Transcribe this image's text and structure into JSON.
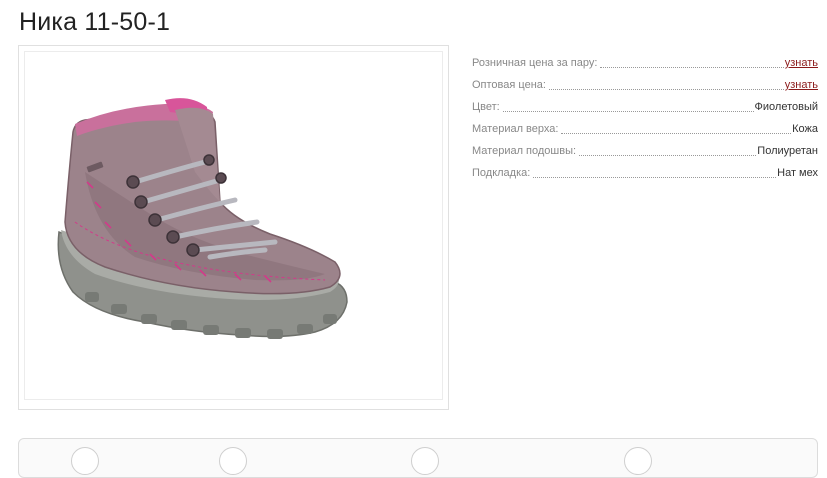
{
  "product": {
    "title": "Ника 11-50-1",
    "image_alt": "Фиолетовый ботинок"
  },
  "specs": [
    {
      "label": "Розничная цена за пару:",
      "value": "узнать",
      "is_link": true
    },
    {
      "label": "Оптовая цена:",
      "value": "узнать",
      "is_link": true
    },
    {
      "label": "Цвет:",
      "value": "Фиолетовый",
      "is_link": false
    },
    {
      "label": "Материал верха:",
      "value": "Кожа",
      "is_link": false
    },
    {
      "label": "Материал подошвы:",
      "value": "Полиуретан",
      "is_link": false
    },
    {
      "label": "Подкладка:",
      "value": "Нат мех",
      "is_link": false
    }
  ],
  "colors": {
    "link": "#8b1a1a",
    "boot_body": "#9a8088",
    "boot_trim": "#d23a8a",
    "sole": "#8a8c88"
  }
}
